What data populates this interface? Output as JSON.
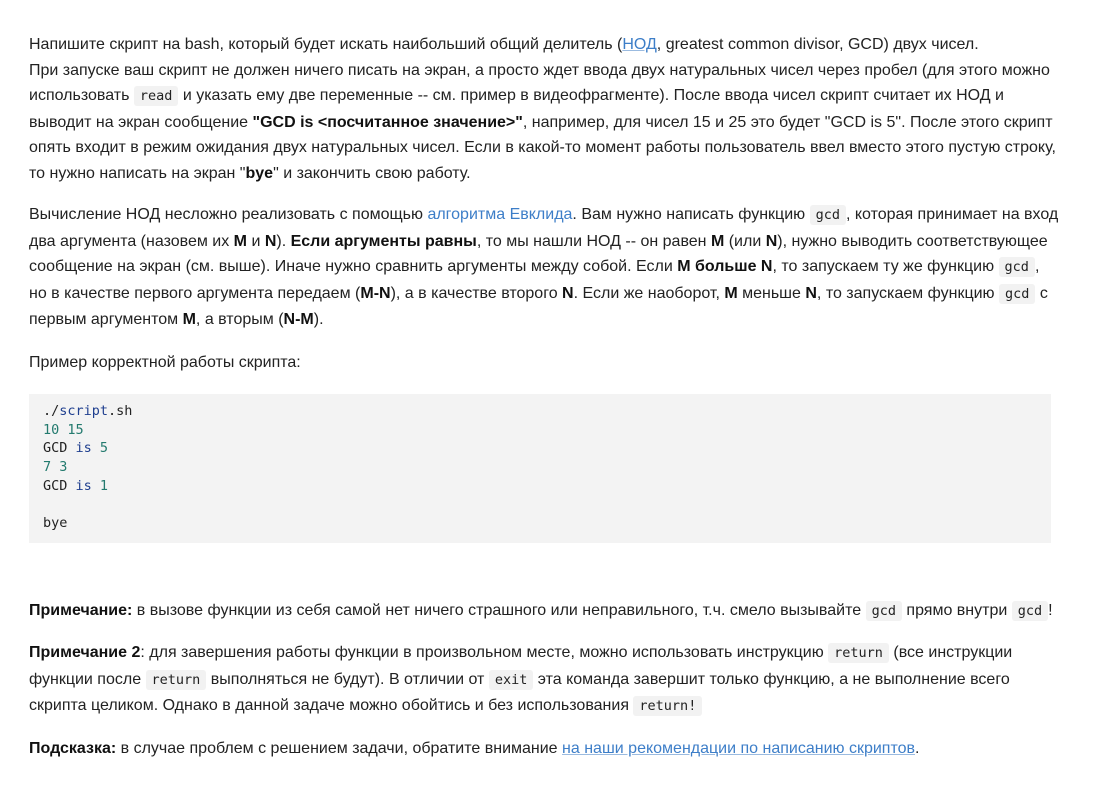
{
  "p1": {
    "line1_pre": "Напишите скрипт на bash, который будет искать наибольший общий делитель (",
    "link_nod": "НОД",
    "line1_post": ", greatest common divisor, GCD) двух чисел.",
    "t2": "При запуске ваш скрипт не должен ничего писать на экран, а просто ждет ввода двух натуральных чисел через пробел (для этого можно использовать ",
    "code_read": "read",
    "t3": " и указать ему две переменные -- см. пример в видеофрагменте). После ввода чисел скрипт считает их НОД и выводит на экран сообщение ",
    "b_gcd": "\"GCD is <посчитанное значение>\"",
    "t4": ", например, для чисел 15 и 25 это будет \"GCD is 5\". После этого скрипт опять входит в режим ожидания двух натуральных чисел. Если в какой-то момент работы пользователь ввел вместо этого пустую строку, то нужно написать на экран \"",
    "b_bye": "bye",
    "t5": "\" и закончить свою работу."
  },
  "p2": {
    "t1": "Вычисление НОД несложно реализовать с помощью ",
    "link_euclid": "алгоритма Евклида",
    "t2": ". Вам нужно написать функцию ",
    "code_gcd": "gcd",
    "t3": ", которая принимает на вход два аргумента (назовем их ",
    "b_m": "M",
    "t4": " и ",
    "b_n": "N",
    "t5": "). ",
    "b_equal": "Если аргументы равны",
    "t6": ", то мы нашли НОД -- он равен ",
    "t7": " (или ",
    "t8": "), нужно выводить соответствующее сообщение на экран (см. выше). Иначе нужно сравнить аргументы между собой. Если ",
    "b_m_more_n": "M больше N",
    "t9": ", то запускаем ту же функцию ",
    "t10": ", но в качестве первого аргумента передаем (",
    "b_m_minus_n": "M-N",
    "t11": "), а в качестве второго ",
    "t12": ". Если же наоборот, ",
    "t13": " меньше ",
    "t14": ", то запускаем функцию ",
    "t15": " с первым аргументом ",
    "t16": ", а вторым (",
    "b_n_minus_m": "N-M",
    "t17": ")."
  },
  "p3": "Пример корректной работы скрипта:",
  "code": {
    "l1_a": "./",
    "l1_b": "script",
    "l1_c": ".sh",
    "l2": "10 15",
    "l3_a": "GCD ",
    "l3_b": "is",
    "l3_c": " ",
    "l3_d": "5",
    "l4": "7 3",
    "l5_a": "GCD ",
    "l5_b": "is",
    "l5_c": " ",
    "l5_d": "1",
    "l7": "bye"
  },
  "note1": {
    "label": "Примечание:",
    "t1": " в вызове функции из себя самой нет ничего страшного или неправильного, т.ч. смело вызывайте ",
    "t2": " прямо внутри ",
    "t3": "!"
  },
  "note2": {
    "label": "Примечание 2",
    "t1": ": для завершения работы функции в произвольном месте, можно использовать инструкцию ",
    "code_return": "return",
    "t2": " (все инструкции функции после ",
    "t3": " выполняться не будут). В отличии от ",
    "code_exit": "exit",
    "t4": " эта команда завершит только функцию, а не выполнение всего скрипта целиком. Однако в данной задаче можно обойтись и без использования ",
    "code_return_bang": "return!"
  },
  "hint": {
    "label": "Подсказка:",
    "t1": " в случае проблем с решением задачи, обратите внимание ",
    "link": "на наши рекомендации по написанию скриптов",
    "t2": "."
  },
  "colors": {
    "link": "#3d7ec8",
    "code_bg": "#f3f3f3",
    "code_keyword": "#1f3f8f",
    "code_number": "#237a6e"
  }
}
